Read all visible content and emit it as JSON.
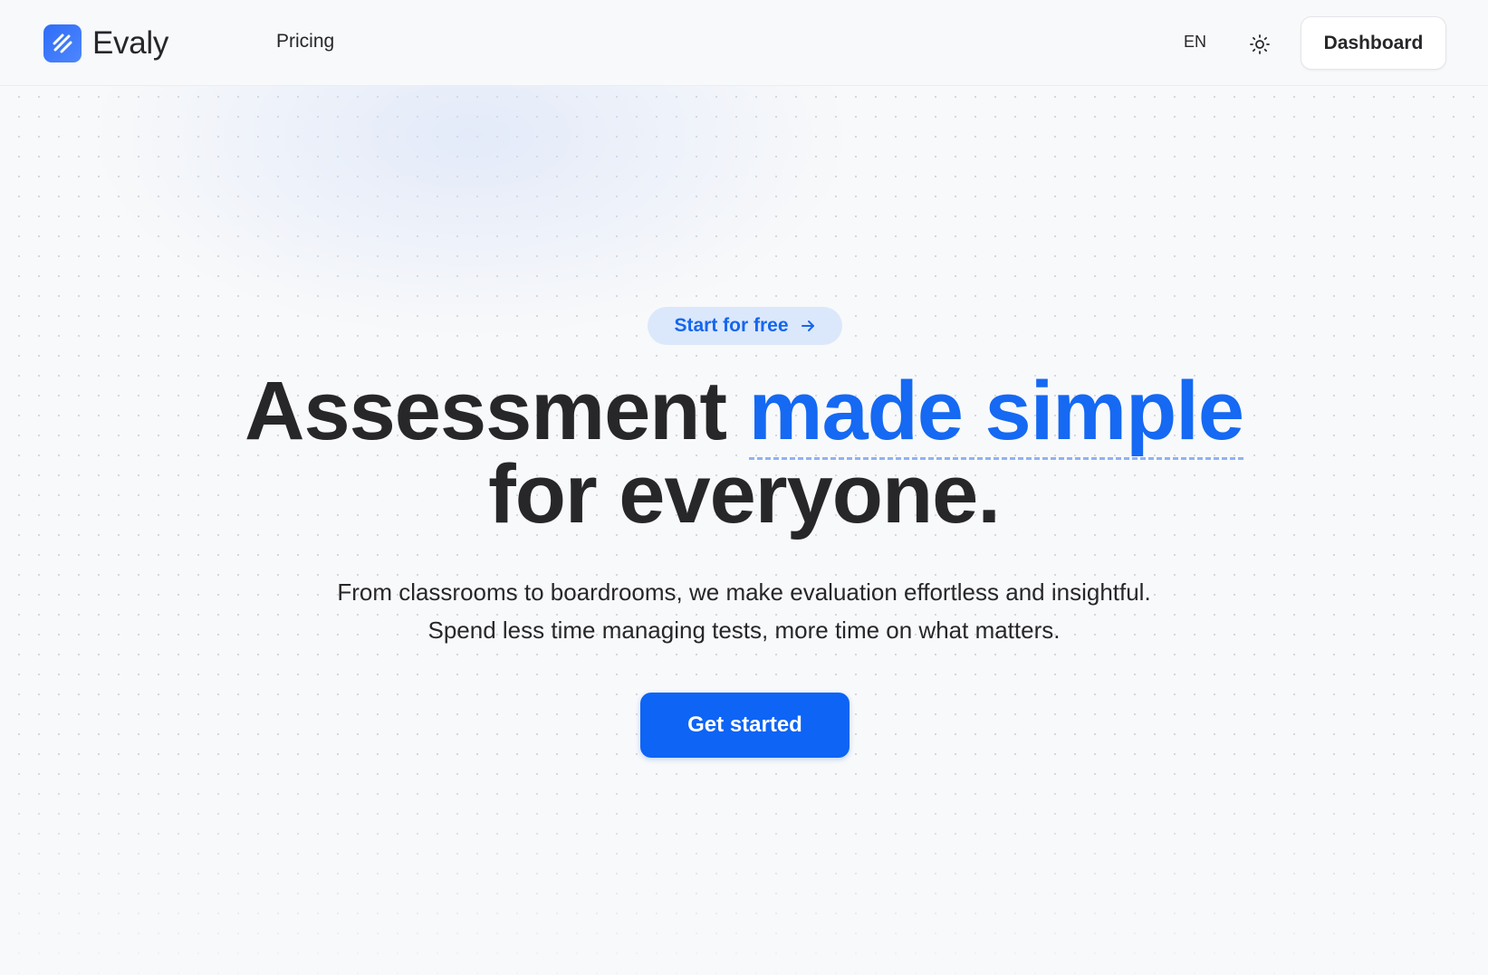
{
  "colors": {
    "accent": "#1569f2",
    "primary_button": "#0d64f5",
    "pill_background": "#dbe8fb",
    "text": "#27272a",
    "background": "#f8f9fa"
  },
  "header": {
    "brand": {
      "name": "Evaly",
      "icon": "evaly-logo-icon"
    },
    "nav": {
      "pricing": "Pricing"
    },
    "language": "EN",
    "theme_toggle_icon": "sun-icon",
    "dashboard_label": "Dashboard"
  },
  "hero": {
    "pill": {
      "label": "Start for free",
      "icon": "arrow-right-icon"
    },
    "headline": {
      "part1": "Assessment ",
      "accent": "made simple",
      "line2": "for everyone."
    },
    "subtitle": {
      "line1": "From classrooms to boardrooms, we make evaluation effortless and insightful.",
      "line2": "Spend less time managing tests, more time on what matters."
    },
    "cta_label": "Get started"
  }
}
